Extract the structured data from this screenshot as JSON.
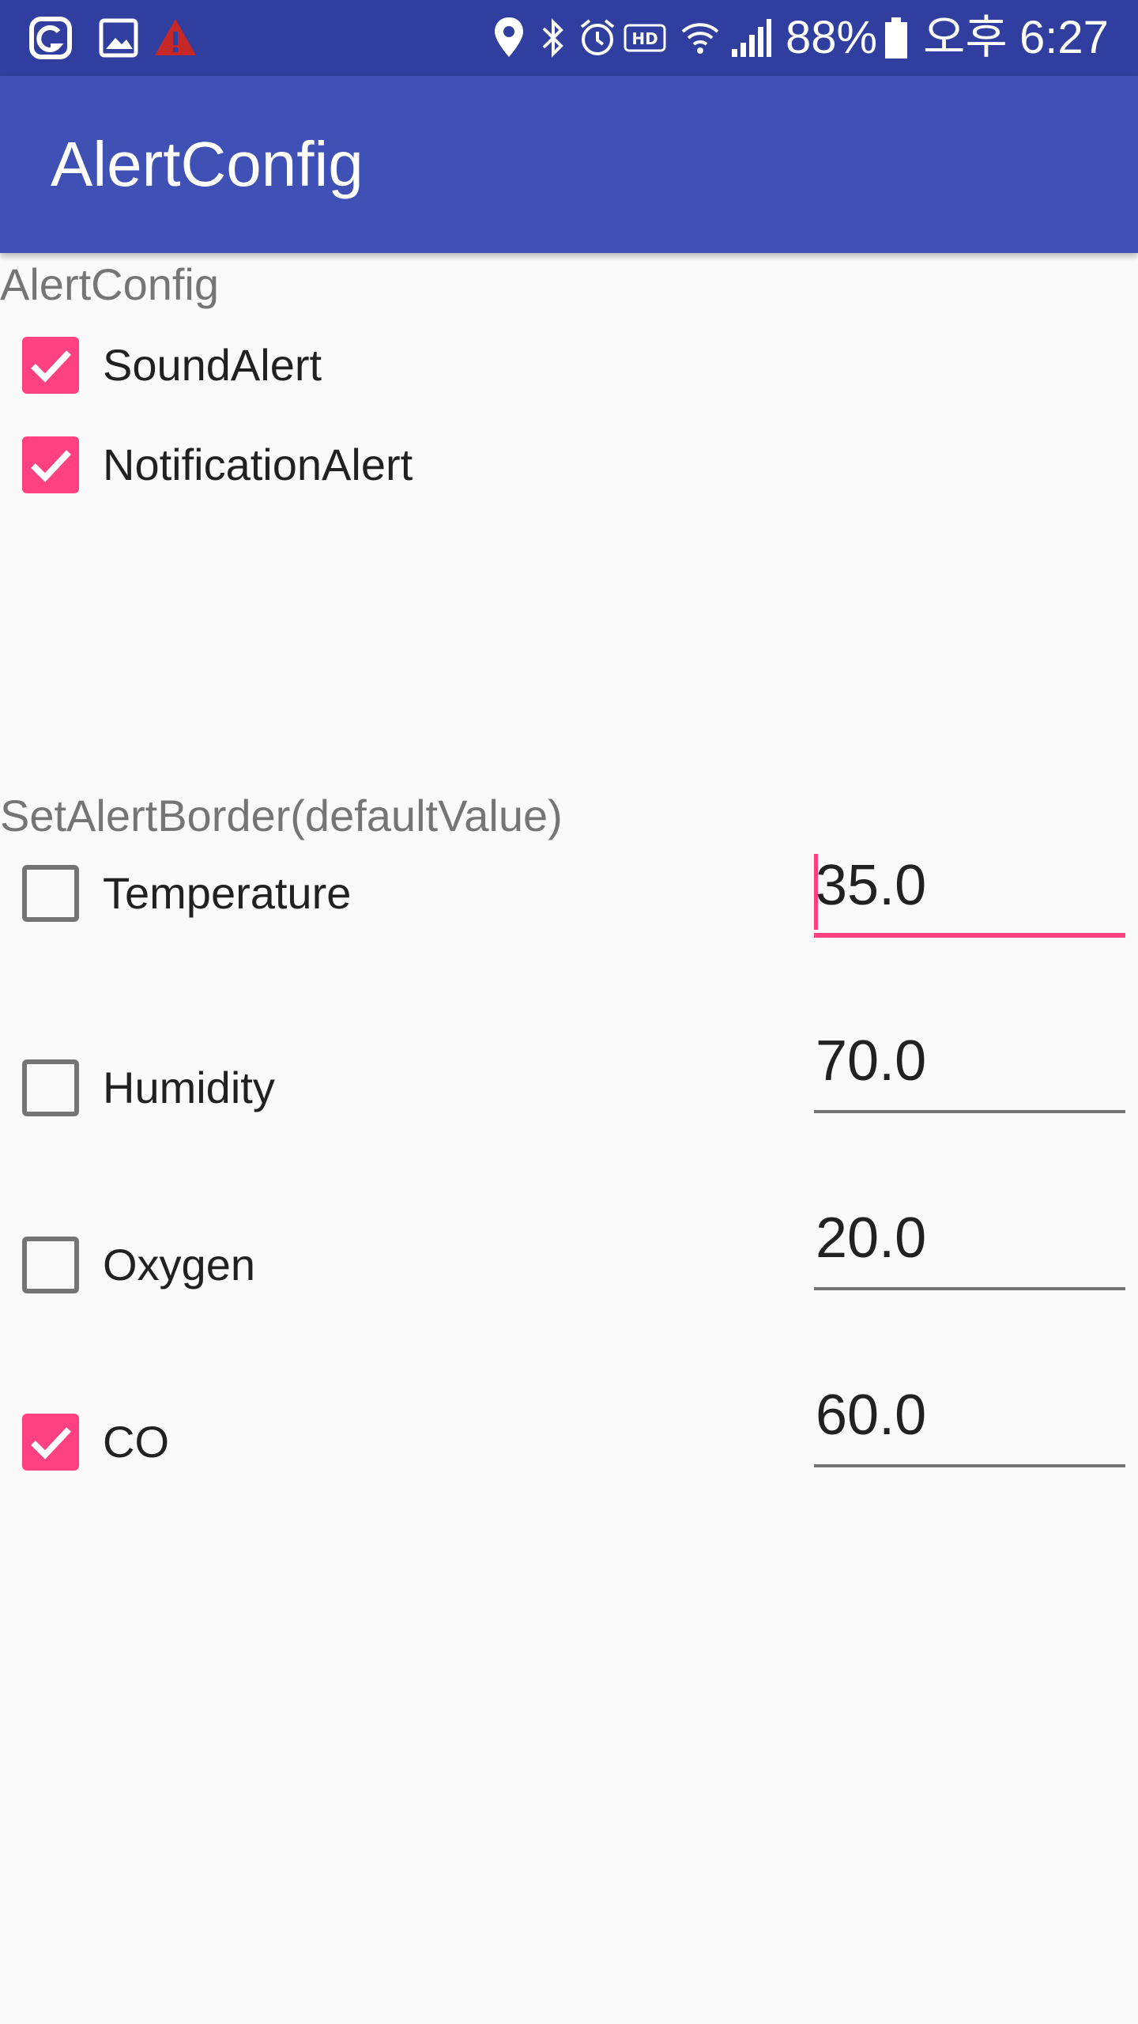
{
  "status_bar": {
    "left_icons": [
      "app-notification-icon",
      "image-icon",
      "warning-icon"
    ],
    "right_icons": [
      "location-icon",
      "bluetooth-icon",
      "alarm-icon",
      "hd-icon",
      "wifi-icon",
      "signal-icon",
      "battery-icon"
    ],
    "battery_percent": "88%",
    "ampm": "오후",
    "time": "6:27"
  },
  "app_bar": {
    "title": "AlertConfig"
  },
  "alert_section": {
    "label": "AlertConfig",
    "options": [
      {
        "label": "SoundAlert",
        "checked": true
      },
      {
        "label": "NotificationAlert",
        "checked": true
      }
    ]
  },
  "border_section": {
    "label": "SetAlertBorder(defaultValue)",
    "rows": [
      {
        "label": "Temperature",
        "checked": false,
        "value": "35.0",
        "focused": true
      },
      {
        "label": "Humidity",
        "checked": false,
        "value": "70.0",
        "focused": false
      },
      {
        "label": "Oxygen",
        "checked": false,
        "value": "20.0",
        "focused": false
      },
      {
        "label": "CO",
        "checked": true,
        "value": "60.0",
        "focused": false
      }
    ]
  },
  "colors": {
    "status_bar": "#303f9f",
    "app_bar": "#3f51b5",
    "accent": "#ff4081",
    "background": "#fafafa"
  }
}
